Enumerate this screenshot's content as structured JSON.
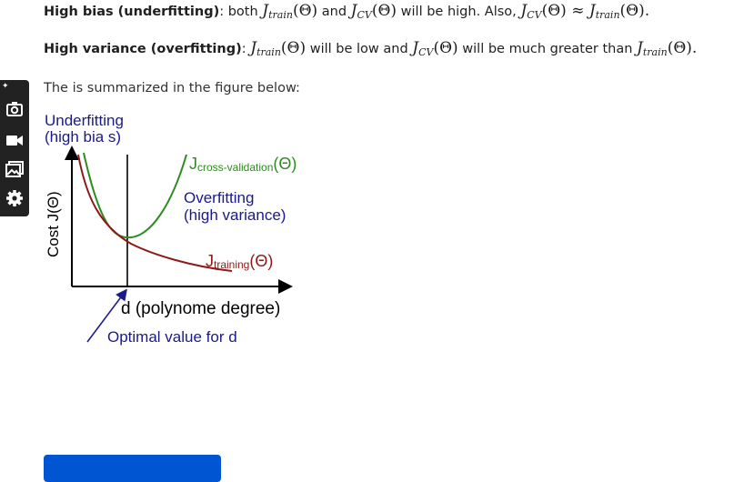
{
  "text": {
    "line1": {
      "bold": "High bias (underfitting)",
      "colon": ":",
      "part1": " both ",
      "jtrain": "J",
      "train_sub": "train",
      "theta": "(Θ)",
      "and": " and ",
      "jcv": "J",
      "cv_sub": "CV",
      "part2": " will be high. Also, ",
      "approx": " ≈ ",
      "end": "."
    },
    "line2": {
      "bold": "High variance (overfitting)",
      "colon": ":",
      "part1": " will be low and ",
      "part2": " will be much greater than ",
      "end": "."
    },
    "line3": "The is summarized in the figure below:"
  },
  "figure": {
    "underfitting_line1": "Underfitting",
    "underfitting_line2": "(high bia s)",
    "y_label": "Cost J(Θ)",
    "cv_label_J": "J",
    "cv_label_sub": "cross-validation",
    "cv_label_theta": "(Θ)",
    "overfitting_line1": "Overfitting",
    "overfitting_line2": "(high variance)",
    "train_label_J": "J",
    "train_label_sub": "training",
    "train_label_theta": "(Θ)",
    "x_label": "d (polynome degree)",
    "optimal_label": "Optimal value for d",
    "colors": {
      "navy": "#1a1a8c",
      "green": "#2e8b1f",
      "red": "#8b1a1a"
    }
  },
  "toolbar": {
    "icons": [
      "pin-icon",
      "camera-icon",
      "video-icon",
      "gallery-icon",
      "settings-icon"
    ]
  },
  "colors": {
    "cta": "#0056d2",
    "toolbar": "#222222"
  }
}
